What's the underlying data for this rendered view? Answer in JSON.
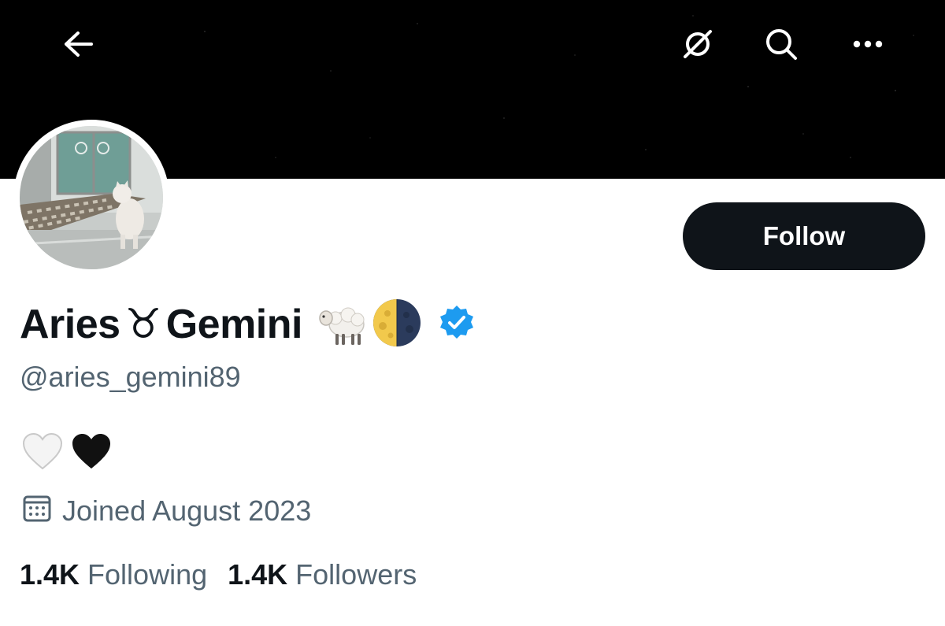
{
  "header": {
    "back_icon": "arrow-left-icon",
    "grok_icon": "slashed-circle-icon",
    "search_icon": "search-icon",
    "more_icon": "more-horizontal-icon",
    "banner_color": "#000000"
  },
  "profile": {
    "display_name_part1": "Aries",
    "display_name_symbol": "♉",
    "display_name_part2": "Gemini",
    "name_emojis": [
      "sheep-emoji",
      "first-quarter-moon-emoji"
    ],
    "verified_badge_color": "#1d9bf0",
    "handle": "@aries_gemini89",
    "bio_emojis": [
      "white-heart-emoji",
      "black-heart-emoji"
    ],
    "joined": "Joined August 2023",
    "following_count": "1.4K",
    "following_label": "Following",
    "followers_count": "1.4K",
    "followers_label": "Followers"
  },
  "actions": {
    "follow_label": "Follow"
  },
  "colors": {
    "primary_text": "#0f1419",
    "secondary_text": "#536471",
    "follow_button_bg": "#0f1419"
  }
}
